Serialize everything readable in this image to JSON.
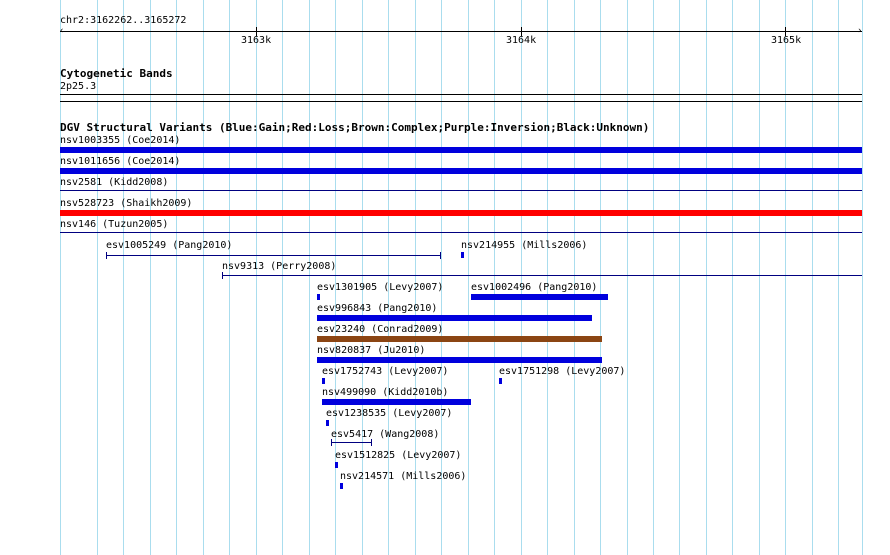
{
  "ruler": {
    "location": "chr2:3162262..3165272",
    "ticks": [
      "3163k",
      "3164k",
      "3165k"
    ]
  },
  "cytobands": {
    "title": "Cytogenetic Bands",
    "band": "2p25.3"
  },
  "dgv": {
    "title": "DGV Structural Variants (Blue:Gain;Red:Loss;Brown:Complex;Purple:Inversion;Black:Unknown)",
    "full_width_features": [
      {
        "label": "nsv1003355 (Coe2014)",
        "type": "Gain"
      },
      {
        "label": "nsv1011656 (Coe2014)",
        "type": "Gain"
      },
      {
        "label": "nsv2581 (Kidd2008)",
        "type": "Unknown"
      },
      {
        "label": "nsv528723 (Shaikh2009)",
        "type": "Loss"
      },
      {
        "label": "nsv146 (Tuzun2005)",
        "type": "Unknown"
      }
    ],
    "features": [
      {
        "label": "esv1005249 (Pang2010)",
        "type": "Unknown"
      },
      {
        "label": "nsv214955 (Mills2006)",
        "type": "Gain"
      },
      {
        "label": "nsv9313 (Perry2008)",
        "type": "Unknown"
      },
      {
        "label": "esv1301905 (Levy2007)",
        "type": "Gain"
      },
      {
        "label": "esv1002496 (Pang2010)",
        "type": "Gain"
      },
      {
        "label": "esv996843 (Pang2010)",
        "type": "Gain"
      },
      {
        "label": "esv23240 (Conrad2009)",
        "type": "Complex"
      },
      {
        "label": "nsv820837 (Ju2010)",
        "type": "Gain"
      },
      {
        "label": "esv1752743 (Levy2007)",
        "type": "Gain"
      },
      {
        "label": "esv1751298 (Levy2007)",
        "type": "Gain"
      },
      {
        "label": "nsv499090 (Kidd2010b)",
        "type": "Gain"
      },
      {
        "label": "esv1238535 (Levy2007)",
        "type": "Gain"
      },
      {
        "label": "esv5417 (Wang2008)",
        "type": "Unknown"
      },
      {
        "label": "esv1512825 (Levy2007)",
        "type": "Gain"
      },
      {
        "label": "nsv214571 (Mills2006)",
        "type": "Gain"
      }
    ]
  },
  "colors": {
    "grid": "#aaddee",
    "gain": "#0000dd",
    "loss": "#ff0000",
    "complex": "#8b4513",
    "inversion": "#800080",
    "unknown": "#000080"
  }
}
